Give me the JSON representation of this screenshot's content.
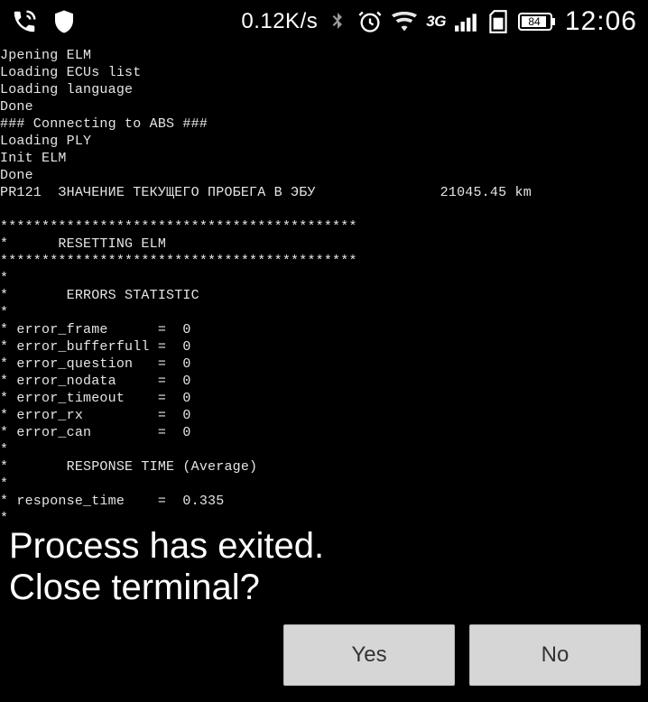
{
  "status_bar": {
    "speed": "0.12K/s",
    "network_label": "3G",
    "battery_level": "84",
    "clock": "12:06"
  },
  "terminal": {
    "lines": [
      "Jpening ELM",
      "Loading ECUs list",
      "Loading language",
      "Done",
      "### Connecting to ABS ###",
      "Loading PLY",
      "Init ELM",
      "Done",
      "PR121  ЗНАЧЕНИЕ ТЕКУЩЕГО ПРОБЕГА В ЭБУ               21045.45 km",
      "",
      "*******************************************",
      "*      RESETTING ELM",
      "*******************************************",
      "*",
      "*       ERRORS STATISTIC",
      "*",
      "* error_frame      =  0",
      "* error_bufferfull =  0",
      "* error_question   =  0",
      "* error_nodata     =  0",
      "* error_timeout    =  0",
      "* error_rx         =  0",
      "* error_can        =  0",
      "*",
      "*       RESPONSE TIME (Average)",
      "*",
      "* response_time    =  0.335",
      "*"
    ]
  },
  "dialog": {
    "message_line1": "Process has exited.",
    "message_line2": "Close terminal?",
    "yes_label": "Yes",
    "no_label": "No"
  }
}
